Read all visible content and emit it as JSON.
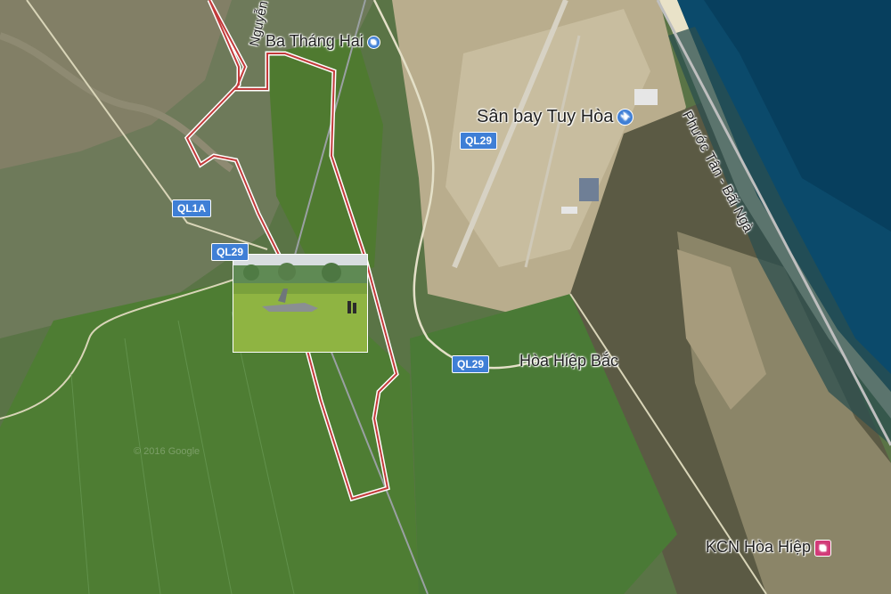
{
  "places": {
    "ba_thang_hai": "Ba Tháng Hai",
    "san_bay": "Sân bay Tuy Hòa",
    "hoa_hiep_bac": "Hòa Hiệp Bắc",
    "kcn_hoa_hiep": "KCN Hòa Hiệp"
  },
  "streets": {
    "nguyen_van": "Nguyễn Văn",
    "phuoc_tan": "Phước Tân - Bãi Ngà"
  },
  "roads": {
    "ql29_top": "QL29",
    "ql1a": "QL1A",
    "ql29_left": "QL29",
    "ql29_bottom": "QL29"
  },
  "icons": {
    "bus": "bus-icon",
    "airport": "airplane-icon",
    "industrial": "factory-icon"
  },
  "colors": {
    "route_outline": "#c23b3b",
    "road_shield": "#3f7fd6",
    "sea": "#0b4a6b",
    "field": "#4f7a32"
  }
}
